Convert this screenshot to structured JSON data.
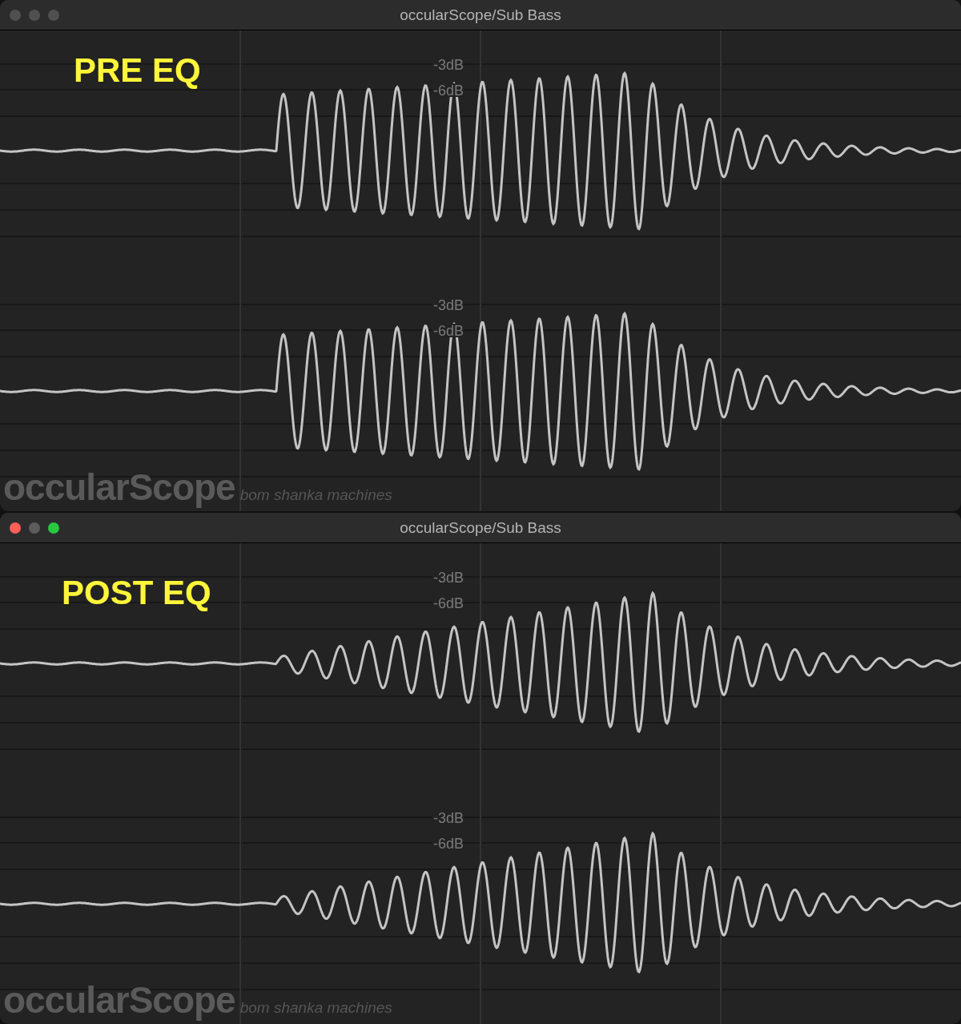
{
  "windows": [
    {
      "title": "occularScope/Sub Bass",
      "active": false,
      "kind": "pre",
      "overlay_label": "PRE EQ",
      "channels": [
        {
          "labels": [
            "-3dB",
            "-6dB"
          ]
        },
        {
          "labels": [
            "-3dB",
            "-6dB"
          ]
        }
      ],
      "logo": "occularScope",
      "tagline": "bom shanka machines"
    },
    {
      "title": "occularScope/Sub Bass",
      "active": true,
      "kind": "post",
      "overlay_label": "POST EQ",
      "channels": [
        {
          "labels": [
            "-3dB",
            "-6dB"
          ]
        },
        {
          "labels": [
            "-3dB",
            "-6dB"
          ]
        }
      ],
      "logo": "occularScope",
      "tagline": "bom shanka machines"
    }
  ]
}
